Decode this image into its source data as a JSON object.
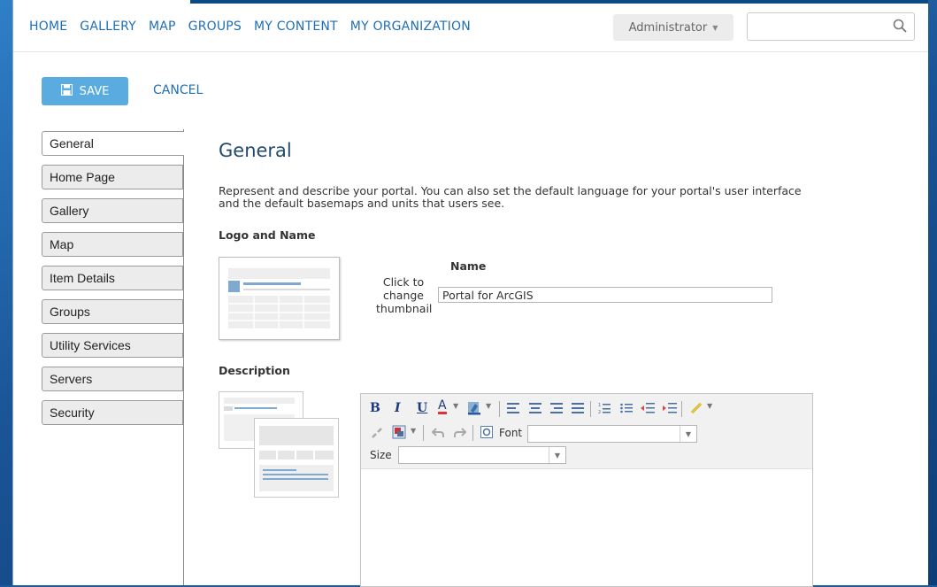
{
  "nav": {
    "items": [
      "HOME",
      "GALLERY",
      "MAP",
      "GROUPS",
      "MY CONTENT",
      "MY ORGANIZATION"
    ]
  },
  "user_menu": {
    "label": "Administrator"
  },
  "search": {
    "value": ""
  },
  "actions": {
    "save_label": "SAVE",
    "cancel_label": "CANCEL"
  },
  "sidebar": {
    "items": [
      {
        "label": "General",
        "active": true
      },
      {
        "label": "Home Page"
      },
      {
        "label": "Gallery"
      },
      {
        "label": "Map"
      },
      {
        "label": "Item Details"
      },
      {
        "label": "Groups"
      },
      {
        "label": "Utility Services"
      },
      {
        "label": "Servers"
      },
      {
        "label": "Security"
      }
    ]
  },
  "main": {
    "title": "General",
    "intro": "Represent and describe your portal. You can also set the default language for your portal's user interface and the default basemaps and units that users see.",
    "logo_section_label": "Logo and Name",
    "thumbnail_hint": "Click to change thumbnail",
    "name_label": "Name",
    "name_value": "Portal for ArcGIS",
    "description_label": "Description"
  },
  "editor": {
    "font_label": "Font",
    "size_label": "Size",
    "font_value": "",
    "size_value": ""
  },
  "colors": {
    "link": "#1f6fb4",
    "save_button": "#5aace0",
    "heading": "#234a6e",
    "desktop": "#1a5596"
  }
}
